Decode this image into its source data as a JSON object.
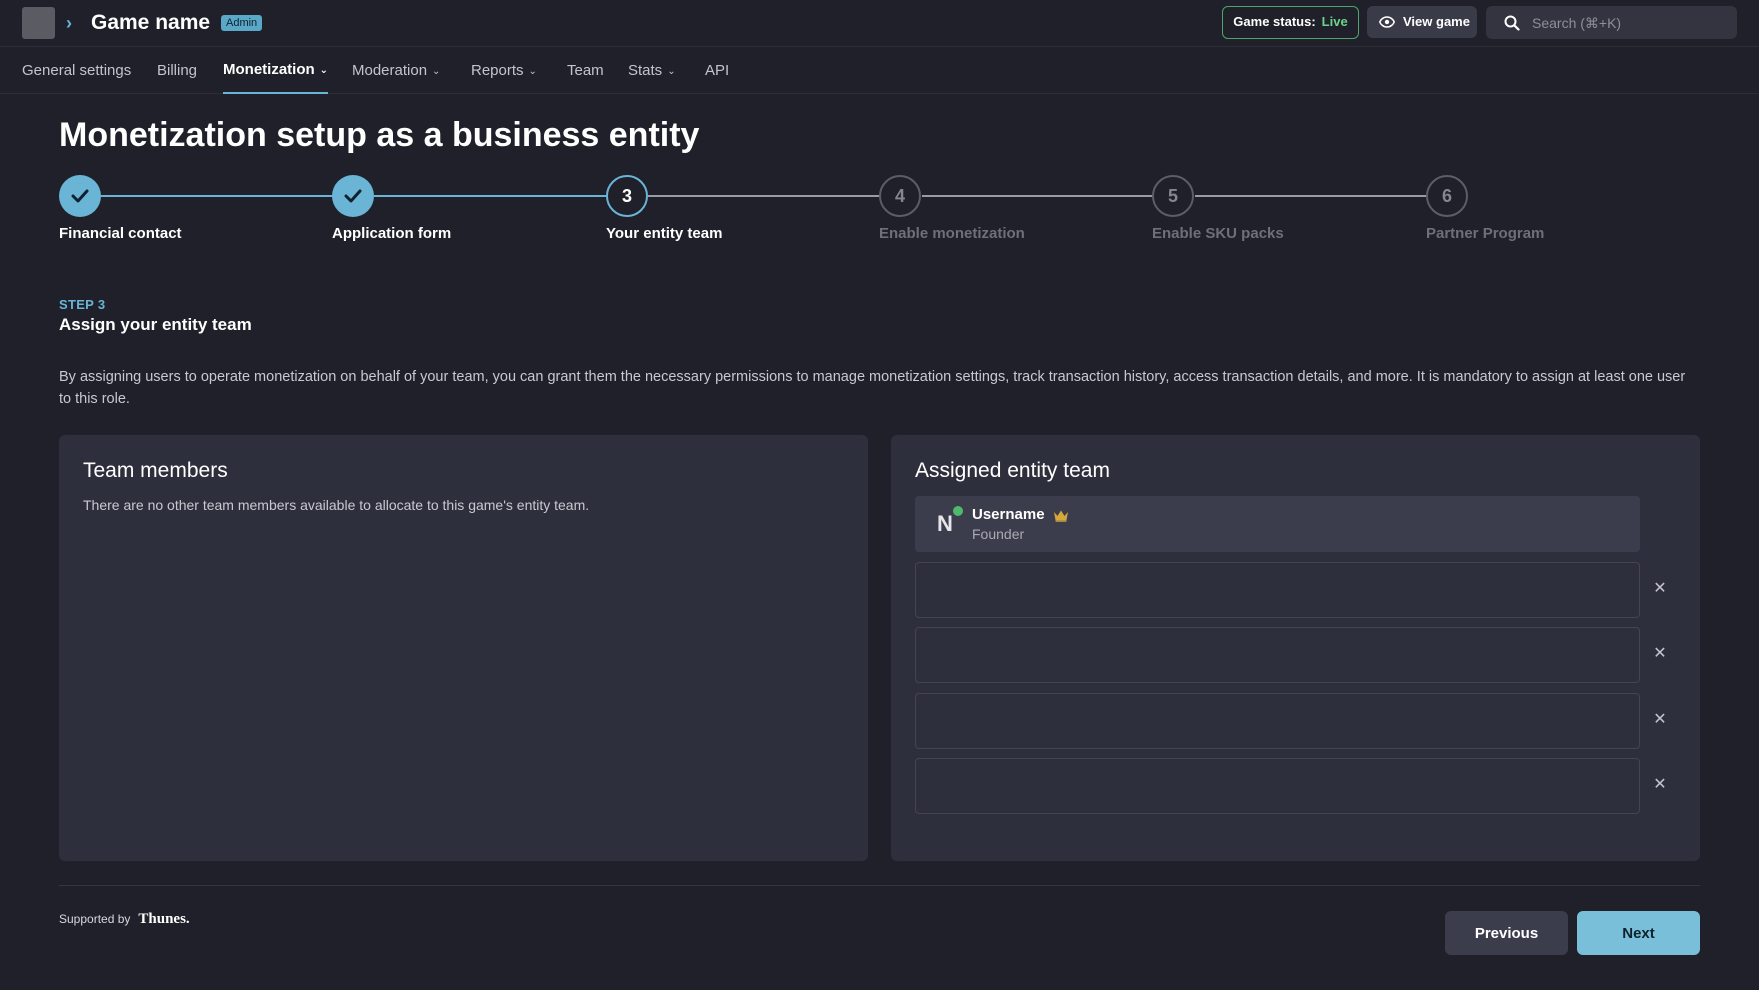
{
  "header": {
    "game_name": "Game name",
    "badge": "Admin",
    "status_label": "Game status:",
    "status_value": "Live",
    "view_game_label": "View game",
    "search_placeholder": "Search (⌘+K)"
  },
  "tabs": [
    {
      "label": "General settings",
      "dropdown": false,
      "active": false
    },
    {
      "label": "Billing",
      "dropdown": false,
      "active": false
    },
    {
      "label": "Monetization",
      "dropdown": true,
      "active": true
    },
    {
      "label": "Moderation",
      "dropdown": true,
      "active": false
    },
    {
      "label": "Reports",
      "dropdown": true,
      "active": false
    },
    {
      "label": "Team",
      "dropdown": false,
      "active": false
    },
    {
      "label": "Stats",
      "dropdown": true,
      "active": false
    },
    {
      "label": "API",
      "dropdown": false,
      "active": false
    }
  ],
  "page_title": "Monetization setup as a business entity",
  "steps": [
    {
      "number": "1",
      "label": "Financial contact",
      "state": "done"
    },
    {
      "number": "2",
      "label": "Application form",
      "state": "done"
    },
    {
      "number": "3",
      "label": "Your entity team",
      "state": "current"
    },
    {
      "number": "4",
      "label": "Enable monetization",
      "state": "todo"
    },
    {
      "number": "5",
      "label": "Enable SKU packs",
      "state": "todo"
    },
    {
      "number": "6",
      "label": "Partner Program",
      "state": "todo"
    }
  ],
  "step_section": {
    "kicker": "STEP 3",
    "title": "Assign your entity team",
    "description": "By assigning users to operate monetization on behalf of your team, you can grant them the necessary permissions to manage monetization settings, track transaction history, access transaction details, and more. It is mandatory to assign at least one user to this role."
  },
  "team_members": {
    "title": "Team members",
    "empty_text": "There are no other team members available to allocate to this game's entity team."
  },
  "assigned_team": {
    "title": "Assigned entity team",
    "member": {
      "initial": "N",
      "name": "Username",
      "role": "Founder",
      "icon": "crown-icon"
    },
    "empty_slots": 4
  },
  "footer": {
    "supported_by": "Supported by",
    "partner": "Thunes.",
    "previous_label": "Previous",
    "next_label": "Next"
  },
  "colors": {
    "background": "#1f2029",
    "card": "#2e2f3c",
    "accent": "#6ab4d6",
    "live": "#6bd38a",
    "next_button": "#79bfd9"
  }
}
